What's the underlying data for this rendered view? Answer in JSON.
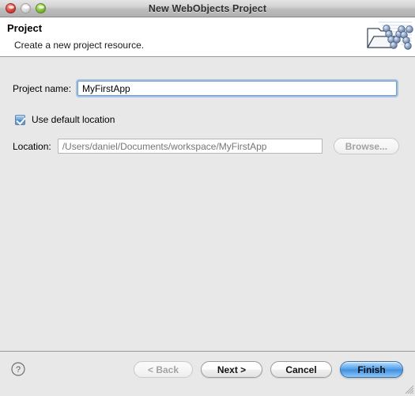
{
  "window": {
    "title": "New WebObjects Project",
    "controls": [
      {
        "name": "close",
        "label": "Close"
      },
      {
        "name": "minimize",
        "label": "Minimize"
      },
      {
        "name": "zoom",
        "label": "Zoom"
      }
    ]
  },
  "header": {
    "title": "Project",
    "description": "Create a new project resource.",
    "icon": "webobjects-project-icon"
  },
  "form": {
    "project_name": {
      "label": "Project name:",
      "value": "MyFirstApp",
      "placeholder": ""
    },
    "use_default_location": {
      "label": "Use default location",
      "checked": true
    },
    "location": {
      "label": "Location:",
      "value": "/Users/daniel/Documents/workspace/MyFirstApp",
      "placeholder": "",
      "disabled": true
    },
    "browse": {
      "label": "Browse...",
      "disabled": true
    }
  },
  "footer": {
    "help": {
      "icon": "help-question-icon",
      "label": "?"
    },
    "buttons": [
      {
        "name": "back",
        "label": "< Back",
        "state": "disabled"
      },
      {
        "name": "next",
        "label": "Next >",
        "state": "enabled"
      },
      {
        "name": "cancel",
        "label": "Cancel",
        "state": "enabled"
      },
      {
        "name": "finish",
        "label": "Finish",
        "state": "default"
      }
    ]
  },
  "colors": {
    "window_background": "#e8e8e8",
    "header_background": "#ffffff",
    "focus_ring": "#6e9fd5",
    "default_button": "#4e9ce8",
    "checkbox_fill": "#4e87c4",
    "disabled_text": "#a3a3a3",
    "location_text": "#767676"
  }
}
